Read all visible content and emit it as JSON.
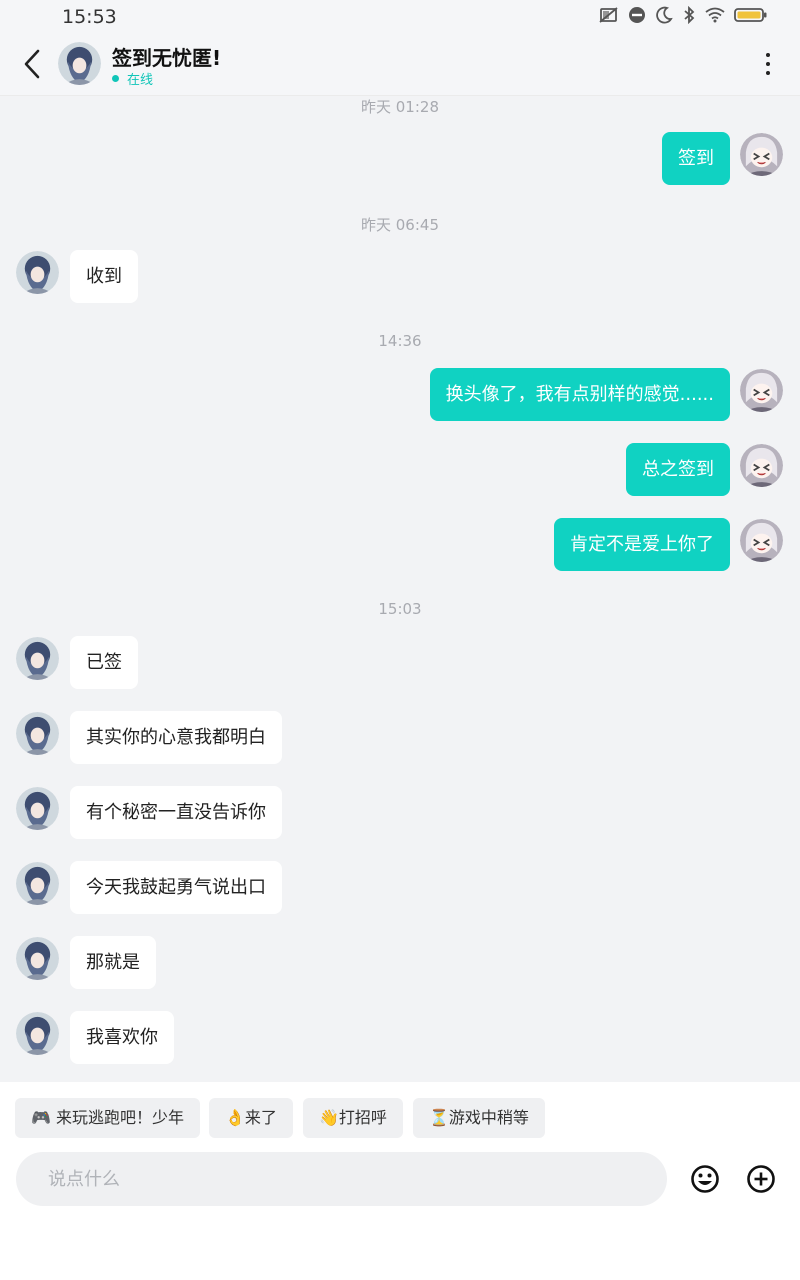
{
  "status_bar": {
    "time": "15:53",
    "icons": [
      "no-sim-icon",
      "do-not-disturb-icon",
      "moon-icon",
      "bluetooth-icon",
      "wifi-icon",
      "battery-icon"
    ]
  },
  "header": {
    "title": "签到无忧匿!",
    "status": "在线",
    "back_icon": "chevron-left-icon",
    "more_icon": "more-vertical-icon"
  },
  "messages": [
    {
      "type": "time",
      "text": "昨天  01:28"
    },
    {
      "type": "msg",
      "side": "right",
      "text": "签到"
    },
    {
      "type": "time",
      "text": "昨天  06:45"
    },
    {
      "type": "msg",
      "side": "left",
      "text": "收到"
    },
    {
      "type": "time",
      "text": "14:36"
    },
    {
      "type": "msg",
      "side": "right",
      "text": "换头像了，我有点别样的感觉......"
    },
    {
      "type": "msg",
      "side": "right",
      "text": "总之签到"
    },
    {
      "type": "msg",
      "side": "right",
      "text": "肯定不是爱上你了"
    },
    {
      "type": "time",
      "text": "15:03"
    },
    {
      "type": "msg",
      "side": "left",
      "text": "已签"
    },
    {
      "type": "msg",
      "side": "left",
      "text": "其实你的心意我都明白"
    },
    {
      "type": "msg",
      "side": "left",
      "text": "有个秘密一直没告诉你"
    },
    {
      "type": "msg",
      "side": "left",
      "text": "今天我鼓起勇气说出口"
    },
    {
      "type": "msg",
      "side": "left",
      "text": "那就是"
    },
    {
      "type": "msg",
      "side": "left",
      "text": "我喜欢你"
    }
  ],
  "quick_replies": [
    "🎮 来玩逃跑吧！少年",
    "👌来了",
    "👋打招呼",
    "⏳游戏中稍等"
  ],
  "input": {
    "placeholder": "说点什么",
    "value": ""
  },
  "actions": {
    "emoji_icon": "emoji-icon",
    "add_icon": "plus-circle-icon"
  },
  "colors": {
    "accent": "#10d2c2",
    "online": "#10c5b8",
    "chat_bg": "#f2f3f5",
    "battery": "#f0c33c"
  }
}
